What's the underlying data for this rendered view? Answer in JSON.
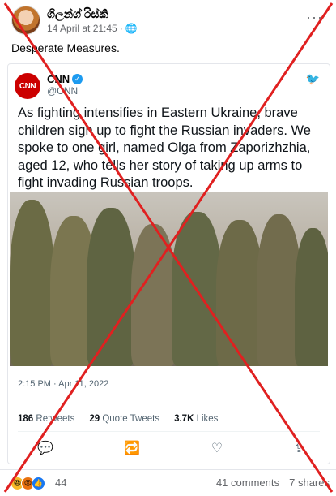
{
  "post": {
    "author": "ගිලන්ග් රිස්කි",
    "timestamp": "14 April at 21:45",
    "more_label": "···",
    "caption": "Desperate Measures."
  },
  "tweet": {
    "name": "CNN",
    "handle": "@CNN",
    "logo_text": "CNN",
    "text": "As fighting intensifies in Eastern Ukraine, brave children sign up to fight the Russian invaders. We spoke to one girl, named Olga from Zaporizhzhia, aged 12, who tells her story of taking up arms to fight invading Russian troops.",
    "time": "2:15 PM · Apr 11, 2022",
    "retweets": "186",
    "retweets_label": "Retweets",
    "quotes": "29",
    "quotes_label": "Quote Tweets",
    "likes": "3.7K",
    "likes_label": "Likes"
  },
  "footer": {
    "reaction_count": "44",
    "comments": "41 comments",
    "shares": "7 shares"
  },
  "colors": {
    "overlay_red": "#e02020",
    "twitter_blue": "#1d9bf0",
    "cnn_red": "#cc0000"
  }
}
